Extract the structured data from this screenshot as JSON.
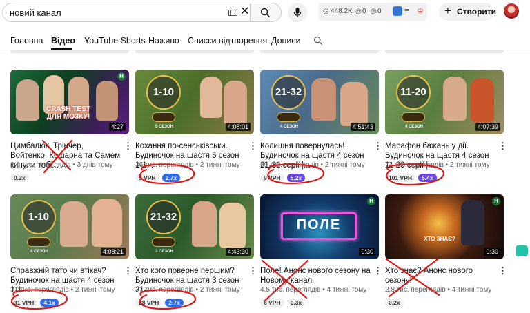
{
  "search": {
    "query": "новий канал"
  },
  "extension": {
    "views": "448.2K",
    "likes": "0",
    "dislikes": "0"
  },
  "header": {
    "create_label": "Створити"
  },
  "tabs": [
    {
      "label": "Головна"
    },
    {
      "label": "Відео"
    },
    {
      "label": "YouTube Shorts"
    },
    {
      "label": "Наживо"
    },
    {
      "label": "Списки відтворення"
    },
    {
      "label": "Дописи"
    }
  ],
  "videos": [
    {
      "title": "Цимбалюк, Трінчер, Войтенко, Кошарна та Самем кинули тобі...",
      "meta": "2,6 тис. переглядів • 3 днів тому",
      "duration": "4:27",
      "chips": [
        "0.2x"
      ],
      "overlay": "CRASH TEST ДЛЯ МОЗКУ!"
    },
    {
      "title": "Кохання по-сенськівськи. Будиночок на щастя 5 сезон 1-1...",
      "meta": "36 тис. переглядів • 2 тижні тому",
      "duration": "4:08:01",
      "chips": [
        "5 VPH",
        "2.7x"
      ],
      "badge": "1-10",
      "season": "5 СЕЗОН"
    },
    {
      "title": "Колишня повернулась! Будиночок на щастя 4 сезон 21-32 серії |...",
      "meta": "69 тис. переглядів • 2 тижні тому",
      "duration": "4:51:43",
      "chips": [
        "9 VPH",
        "5.2x"
      ],
      "badge": "21-32",
      "season": "4 СЕЗОН"
    },
    {
      "title": "Марафон бажань у дії. Будиночок на щастя 4 сезон 11-20 серії |...",
      "meta": "73 тис. переглядів • 2 тижні тому",
      "duration": "4:07:39",
      "chips": [
        "101 VPH",
        "5.4x"
      ],
      "badge": "11-20",
      "season": "4 СЕЗОН"
    },
    {
      "title": "Справжній тато чи втікач? Будиночок на щастя 4 сезон 1-1...",
      "meta": "31 тис. переглядів • 2 тижні тому",
      "duration": "4:08:21",
      "chips": [
        "31 VPH",
        "4.1x"
      ],
      "badge": "1-10",
      "season": "4 СЕЗОН"
    },
    {
      "title": "Хто кого поверне першим? Будиночок на щастя 3 сезон 21-...",
      "meta": "37 тис. переглядів • 2 тижні тому",
      "duration": "4:43:30",
      "chips": [
        "28 VPH",
        "2.7x"
      ],
      "badge": "21-32",
      "season": "3 СЕЗОН"
    },
    {
      "title": "Поле! Анонс нового сезону на Новому каналі",
      "meta": "4,5 тис. переглядів • 4 тижні тому",
      "duration": "0:30",
      "chips": [
        "6 VPH",
        "0.3x"
      ],
      "overlay": "ПОЛЕ"
    },
    {
      "title": "Хто знає? Анонс нового сезону!",
      "meta": "2,8 тис. переглядів • 4 тижні тому",
      "duration": "0:30",
      "chips": [
        "0.2x"
      ],
      "overlay": "ХТО ЗНАЄ?"
    }
  ],
  "colors": {
    "chip_blue": "#2f6bf0",
    "chip_purple": "#6b46e3",
    "annotation_red": "#d81b1b"
  }
}
